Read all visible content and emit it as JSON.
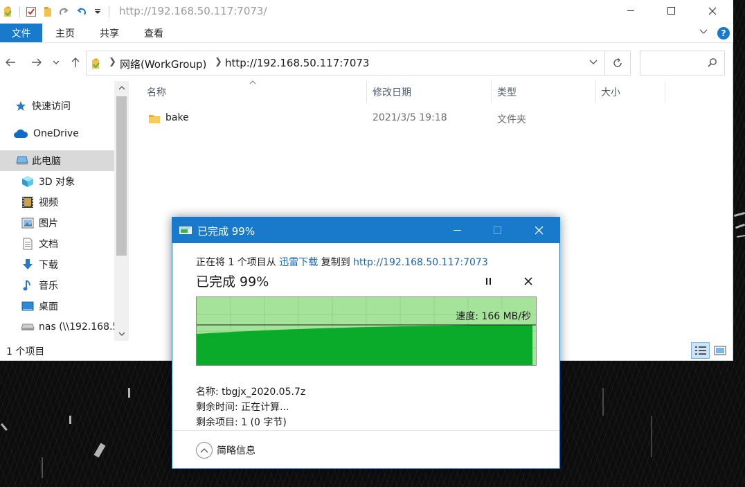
{
  "explorer": {
    "title_path": "http://192.168.50.117:7073/",
    "ribbon_tabs": [
      "文件",
      "主页",
      "共享",
      "查看"
    ],
    "address": {
      "crumbs": [
        "网络(WorkGroup)",
        "http://192.168.50.117:7073"
      ]
    },
    "search": {
      "placeholder": ""
    },
    "nav_items": [
      {
        "label": "快速访问",
        "icon": "star-icon"
      },
      {
        "label": "OneDrive",
        "icon": "cloud-icon"
      },
      {
        "label": "此电脑",
        "icon": "computer-icon"
      },
      {
        "label": "3D 对象",
        "icon": "cube-icon"
      },
      {
        "label": "视频",
        "icon": "film-icon"
      },
      {
        "label": "图片",
        "icon": "picture-icon"
      },
      {
        "label": "文档",
        "icon": "document-icon"
      },
      {
        "label": "下载",
        "icon": "download-arrow-icon"
      },
      {
        "label": "音乐",
        "icon": "music-note-icon"
      },
      {
        "label": "桌面",
        "icon": "desktop-icon"
      },
      {
        "label": "nas (\\\\192.168.5",
        "icon": "network-drive-icon"
      }
    ],
    "columns": [
      "名称",
      "修改日期",
      "类型",
      "大小"
    ],
    "files": [
      {
        "name": "bake",
        "modified": "2021/3/5 19:18",
        "type": "文件夹",
        "size": ""
      }
    ],
    "status": "1 个项目"
  },
  "dialog": {
    "title": "已完成 99%",
    "copy_line": {
      "prefix": "正在将 1 个项目从 ",
      "source": "迅雷下载",
      "middle": " 复制到 ",
      "destination": "http://192.168.50.117:7073"
    },
    "heading": "已完成 99%",
    "speed": "速度: 166 MB/秒",
    "name_label": "名称: tbgjx_2020.05.7z",
    "time_left": "剩余时间: 正在计算...",
    "items_left": "剩余项目: 1 (0 字节)",
    "less_details": "简略信息",
    "progress": 0.99
  },
  "colors": {
    "accent": "#1979ca",
    "graph_fill": "#0aab2a",
    "graph_background": "#a6e39a"
  }
}
